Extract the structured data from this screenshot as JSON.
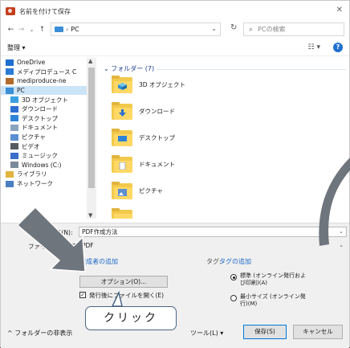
{
  "window": {
    "title": "名前を付けて保存",
    "close": "✕"
  },
  "nav": {
    "back": "←",
    "forward": "→",
    "down": "⌄",
    "up": "↑",
    "address": "PC",
    "address_sep": "›",
    "refresh": "↻",
    "search_placeholder": "PCの検索"
  },
  "toolbar": {
    "organize": "整理 ▾",
    "view": "☷ ▾",
    "help": "?"
  },
  "tree": [
    {
      "label": "OneDrive",
      "color": "#1f6fd0"
    },
    {
      "label": "メディプロデュース C",
      "color": "#2b7bd6"
    },
    {
      "label": "mediproduce-ne",
      "color": "#b36b2b"
    },
    {
      "label": "PC",
      "color": "#3c8fd6",
      "selected": true
    },
    {
      "label": "3D オブジェクト",
      "color": "#3aa0e0",
      "indent": true
    },
    {
      "label": "ダウンロード",
      "color": "#2d6fd2",
      "indent": true
    },
    {
      "label": "デスクトップ",
      "color": "#2f84d8",
      "indent": true
    },
    {
      "label": "ドキュメント",
      "color": "#8aa4c0",
      "indent": true
    },
    {
      "label": "ピクチャ",
      "color": "#5b8fd0",
      "indent": true
    },
    {
      "label": "ビデオ",
      "color": "#555a60",
      "indent": true
    },
    {
      "label": "ミュージック",
      "color": "#3a6fc9",
      "indent": true
    },
    {
      "label": "Windows (C:)",
      "color": "#7a8a9a",
      "indent": true
    },
    {
      "label": "ライブラリ",
      "color": "#e2b43e"
    },
    {
      "label": "ネットワーク",
      "color": "#4a7fc0"
    }
  ],
  "group_header": "⌄ フォルダー (7)",
  "folders": [
    {
      "label": "3D オブジェクト",
      "badge": "cube"
    },
    {
      "label": "ダウンロード",
      "badge": "download"
    },
    {
      "label": "デスクトップ",
      "badge": "desktop"
    },
    {
      "label": "ドキュメント",
      "badge": "document"
    },
    {
      "label": "ピクチャ",
      "badge": "picture"
    },
    {
      "label": "",
      "badge": "none"
    }
  ],
  "fields": {
    "filename_label": "ファイル名(N):",
    "filename_value": "PDF作成方法",
    "filetype_label": "ファイルの種類(T):",
    "filetype_value": "PDF"
  },
  "meta": {
    "authors_link": "作成者の追加",
    "tags_label": "タグ:",
    "tags_link": "タグの追加",
    "options_button": "オプション(O)...",
    "open_after_check": "✓",
    "open_after_label": "発行後にファイルを開く(E)",
    "optimize_standard": "標準 (オンライン発行およ\nび印刷)(A)",
    "optimize_minimum": "最小サイズ (オンライン発\n行)(M)"
  },
  "footer": {
    "hide_folders": "^ フォルダーの非表示",
    "tools": "ツール(L) ▾",
    "save": "保存(S)",
    "cancel": "キャンセル"
  },
  "annotation": {
    "callout_text": "クリック"
  },
  "colors": {
    "accent": "#0078d7",
    "arrow": "#6f757c",
    "folder": "#ffd866"
  }
}
